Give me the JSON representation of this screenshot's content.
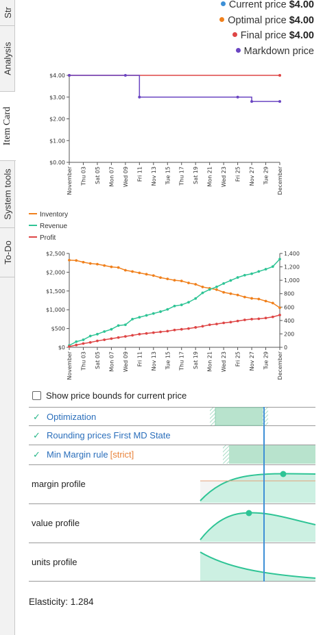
{
  "side_tabs": [
    {
      "label": "Str",
      "active": false
    },
    {
      "label": "Analysis",
      "active": false
    },
    {
      "label": "Item Card",
      "active": true
    },
    {
      "label": "System tools",
      "active": false
    },
    {
      "label": "To-Do",
      "active": false
    }
  ],
  "price_legend": [
    {
      "label": "Current price",
      "value": "$4.00",
      "color": "#3d8fd6"
    },
    {
      "label": "Optimal price",
      "value": "$4.00",
      "color": "#f0801c"
    },
    {
      "label": "Final price",
      "value": "$4.00",
      "color": "#de4545"
    },
    {
      "label": "Markdown price",
      "value": "",
      "color": "#6a45c2"
    }
  ],
  "series_legend": [
    {
      "label": "Inventory",
      "color": "#f0801c"
    },
    {
      "label": "Revenue",
      "color": "#2ec495"
    },
    {
      "label": "Profit",
      "color": "#de4545"
    }
  ],
  "chart_data": [
    {
      "type": "line",
      "x": [
        "November",
        "Thu 03",
        "Sat 05",
        "Mon 07",
        "Wed 09",
        "Fri 11",
        "Nov 13",
        "Tue 15",
        "Thu 17",
        "Sat 19",
        "Mon 21",
        "Wed 23",
        "Fri 25",
        "Nov 27",
        "Tue 29",
        "December"
      ],
      "ylim": [
        0,
        4
      ],
      "yticks": [
        "$0.00",
        "$1.00",
        "$2.00",
        "$3.00",
        "$4.00"
      ],
      "series": [
        {
          "name": "Final price",
          "color": "#de4545",
          "values": [
            4,
            4,
            4,
            4,
            4,
            4,
            4,
            4,
            4,
            4,
            4,
            4,
            4,
            4,
            4,
            4
          ]
        },
        {
          "name": "Markdown price",
          "color": "#6a45c2",
          "values": [
            4,
            4,
            4,
            4,
            4,
            3,
            3,
            3,
            3,
            3,
            3,
            3,
            3,
            2.8,
            2.8,
            2.8
          ]
        }
      ]
    },
    {
      "type": "line",
      "x_days": 31,
      "xticks": [
        "November",
        "Thu 03",
        "Sat 05",
        "Mon 07",
        "Wed 09",
        "Fri 11",
        "Nov 13",
        "Tue 15",
        "Thu 17",
        "Sat 19",
        "Mon 21",
        "Wed 23",
        "Fri 25",
        "Nov 27",
        "Tue 29",
        "December"
      ],
      "ylim_left": [
        0,
        2500
      ],
      "yticks_left": [
        "$0",
        "$500",
        "$1,000",
        "$1,500",
        "$2,000",
        "$2,500"
      ],
      "ylim_right": [
        0,
        1400
      ],
      "yticks_right": [
        "0",
        "200",
        "400",
        "600",
        "800",
        "1,000",
        "1,200",
        "1,400"
      ],
      "series": [
        {
          "name": "Inventory",
          "axis": "right",
          "color": "#f0801c",
          "values": [
            1300,
            1295,
            1270,
            1250,
            1240,
            1220,
            1200,
            1190,
            1150,
            1130,
            1110,
            1090,
            1070,
            1040,
            1020,
            1000,
            990,
            960,
            940,
            900,
            880,
            860,
            820,
            800,
            780,
            750,
            730,
            720,
            690,
            660,
            590
          ]
        },
        {
          "name": "Revenue",
          "axis": "left",
          "color": "#2ec495",
          "values": [
            50,
            150,
            200,
            300,
            350,
            420,
            480,
            580,
            600,
            750,
            800,
            850,
            900,
            950,
            1010,
            1100,
            1130,
            1200,
            1300,
            1450,
            1540,
            1610,
            1700,
            1780,
            1860,
            1920,
            1960,
            2020,
            2080,
            2150,
            2350
          ]
        },
        {
          "name": "Profit",
          "axis": "left",
          "color": "#de4545",
          "values": [
            20,
            60,
            100,
            130,
            170,
            200,
            230,
            260,
            290,
            320,
            350,
            370,
            390,
            410,
            430,
            460,
            480,
            500,
            530,
            560,
            600,
            620,
            650,
            670,
            700,
            730,
            750,
            760,
            780,
            810,
            860
          ]
        }
      ]
    }
  ],
  "bounds_toggle": {
    "label": "Show price bounds for current price"
  },
  "rules": [
    {
      "label": "Optimization",
      "strict": ""
    },
    {
      "label": "Rounding prices First MD State",
      "strict": ""
    },
    {
      "label": "Min Margin rule",
      "strict": "[strict]"
    }
  ],
  "profiles": [
    {
      "label": "margin profile"
    },
    {
      "label": "value profile"
    },
    {
      "label": "units profile"
    }
  ],
  "elasticity": "Elasticity: 1.284"
}
